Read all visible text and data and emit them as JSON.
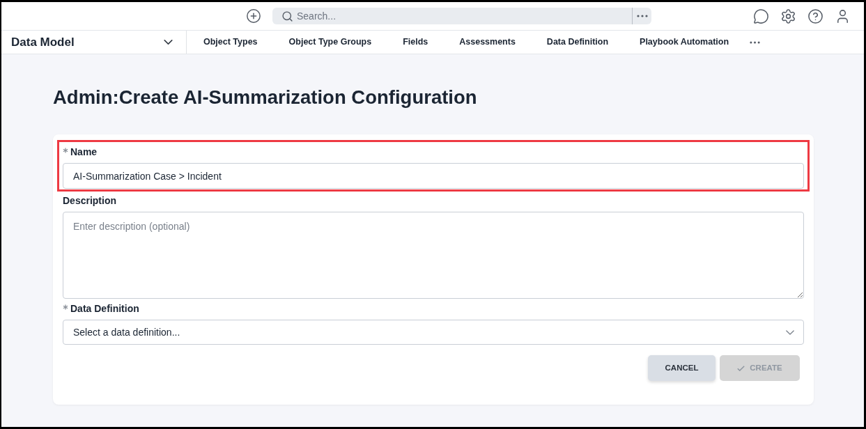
{
  "top_bar": {
    "search": {
      "placeholder": "Search..."
    }
  },
  "nav": {
    "section": "Data Model",
    "items": [
      {
        "label": "Object Types"
      },
      {
        "label": "Object Type Groups"
      },
      {
        "label": "Fields"
      },
      {
        "label": "Assessments"
      },
      {
        "label": "Data Definition"
      },
      {
        "label": "Playbook Automation"
      }
    ]
  },
  "page_title": "Admin:Create AI-Summarization Configuration",
  "form": {
    "fields": [
      {
        "kind": "text",
        "label": "Name",
        "required": true,
        "highlighted": true,
        "value": "AI-Summarization Case > Incident"
      },
      {
        "kind": "textarea",
        "label": "Description",
        "required": false,
        "highlighted": false,
        "placeholder": "Enter description (optional)"
      },
      {
        "kind": "select",
        "label": "Data Definition",
        "required": true,
        "highlighted": false,
        "placeholder": "Select a data definition..."
      }
    ],
    "buttons": [
      {
        "label": "CANCEL",
        "kind": "secondary",
        "disabled": false
      },
      {
        "label": "CREATE",
        "kind": "primary",
        "disabled": true
      }
    ]
  }
}
